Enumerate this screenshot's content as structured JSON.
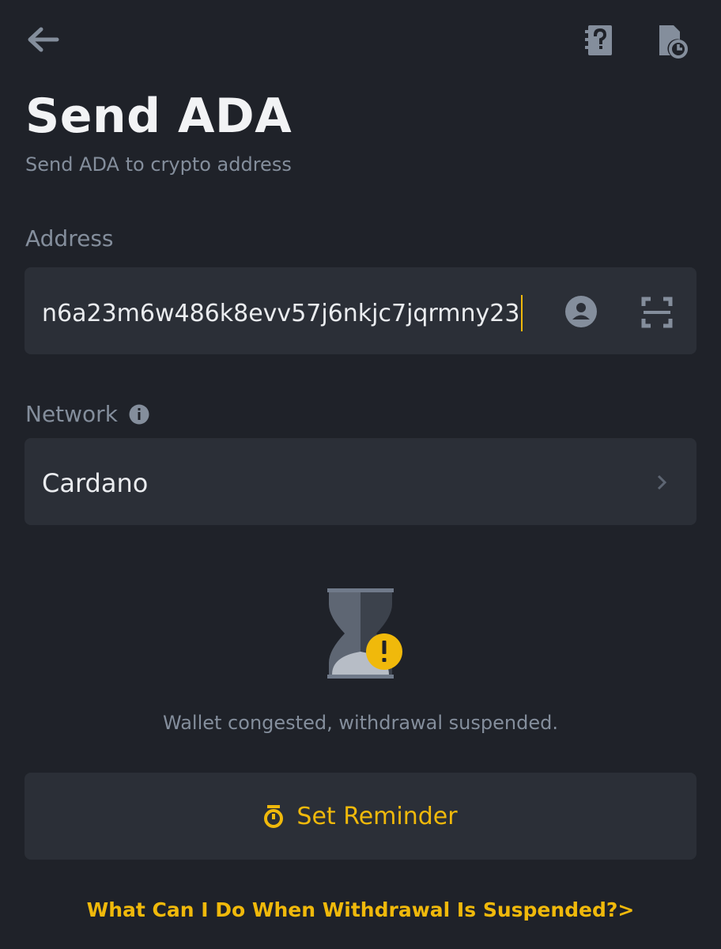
{
  "header": {
    "back_icon": "arrow-left-icon",
    "faq_icon": "question-document-icon",
    "history_icon": "document-clock-icon",
    "title": "Send ADA",
    "subtitle": "Send ADA to crypto address"
  },
  "address": {
    "label": "Address",
    "value": "n6a23m6w486k8evv57j6nkjc7jqrmny23",
    "contact_icon": "contact-icon",
    "scan_icon": "scan-icon"
  },
  "network": {
    "label": "Network",
    "info_icon": "info-icon",
    "value": "Cardano",
    "chevron_icon": "chevron-right-icon"
  },
  "status": {
    "icon": "hourglass-warning-icon",
    "message": "Wallet congested, withdrawal suspended."
  },
  "reminder": {
    "icon": "timer-icon",
    "label": "Set Reminder"
  },
  "help_link": "What Can I Do When Withdrawal Is Suspended?>",
  "colors": {
    "background": "#1f2229",
    "card": "#2b2f37",
    "accent": "#f0b90b",
    "muted_text": "#848e9c",
    "primary_text": "#eaecef"
  }
}
